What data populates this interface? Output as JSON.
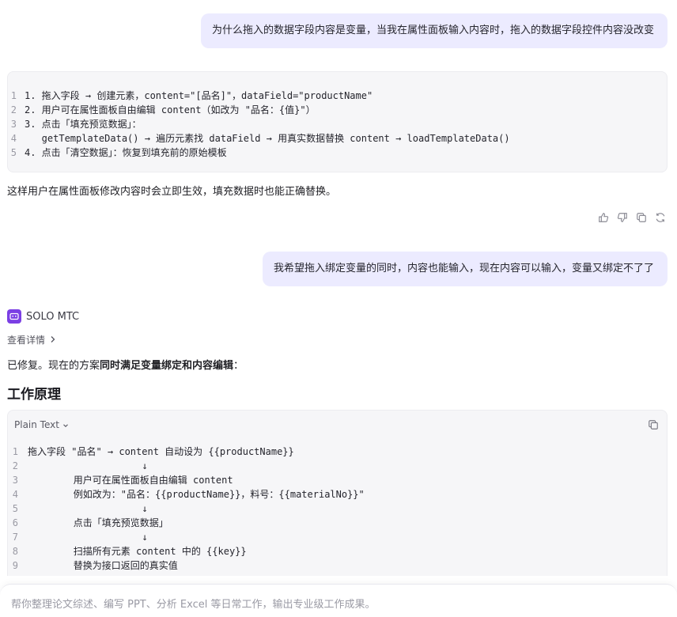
{
  "messages": {
    "user1": "为什么拖入的数据字段内容是变量，当我在属性面板输入内容时，拖入的数据字段控件内容没改变",
    "user2": "我希望拖入绑定变量的同时，内容也能输入，现在内容可以输入，变量又绑定不了了"
  },
  "flow_code": {
    "lines": [
      {
        "n": "1",
        "text": "1. 拖入字段 → 创建元素，content=\"[品名]\"，dataField=\"productName\""
      },
      {
        "n": "2",
        "text": "2. 用户可在属性面板自由编辑 content（如改为 \"品名：{值}\"）"
      },
      {
        "n": "3",
        "text": "3. 点击「填充预览数据」："
      },
      {
        "n": "4",
        "text": "   getTemplateData() → 遍历元素找 dataField → 用真实数据替换 content → loadTemplateData()"
      },
      {
        "n": "5",
        "text": "4. 点击「清空数据」：恢复到填充前的原始模板"
      }
    ]
  },
  "summary": "这样用户在属性面板修改内容时会立即生效，填充数据时也能正确替换。",
  "actions": {
    "like_icon": "thumbs-up-icon",
    "dislike_icon": "thumbs-down-icon",
    "copy_icon": "copy-icon",
    "regenerate_icon": "refresh-icon"
  },
  "agent": {
    "name": "SOLO MTC",
    "details_label": "查看详情"
  },
  "fixed": {
    "prefix": "已修复。现在的方案",
    "bold": "同时满足变量绑定和内容编辑",
    "suffix": "："
  },
  "heading": "工作原理",
  "work_code": {
    "language": "Plain Text",
    "lines": [
      {
        "n": "1",
        "text": "拖入字段 \"品名\" → content 自动设为 {{productName}}"
      },
      {
        "n": "2",
        "text": "                    ↓"
      },
      {
        "n": "3",
        "text": "        用户可在属性面板自由编辑 content"
      },
      {
        "n": "4",
        "text": "        例如改为：\"品名：{{productName}}，料号：{{materialNo}}\""
      },
      {
        "n": "5",
        "text": "                    ↓"
      },
      {
        "n": "6",
        "text": "        点击「填充预览数据」"
      },
      {
        "n": "7",
        "text": "                    ↓"
      },
      {
        "n": "8",
        "text": "        扫描所有元素 content 中的 {{key}}"
      },
      {
        "n": "9",
        "text": "        替换为接口返回的真实值"
      }
    ]
  },
  "composer": {
    "placeholder": "帮你整理论文综述、编写 PPT、分析 Excel 等日常工作，输出专业级工作成果。"
  },
  "colors": {
    "user_bubble": "#ecebff",
    "code_bg": "#f6f6f8",
    "brand": "#7b3fe4"
  }
}
